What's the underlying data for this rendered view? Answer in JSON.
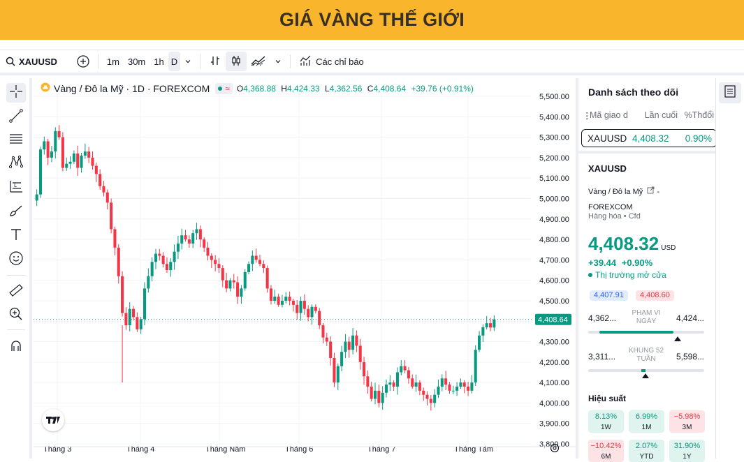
{
  "banner": {
    "title": "GIÁ VÀNG THẾ GIỚI"
  },
  "toolbar": {
    "symbol": "XAUUSD",
    "intervals": [
      "1m",
      "30m",
      "1h",
      "D"
    ],
    "indicators_label": "Các chỉ báo"
  },
  "legend": {
    "title": "Vàng / Đô la Mỹ · 1D · FOREXCOM",
    "o_label": "O",
    "o": "4,368.88",
    "h_label": "H",
    "h": "4,424.33",
    "l_label": "L",
    "l": "4,362.56",
    "c_label": "C",
    "c": "4,408.64",
    "change": "+39.76 (+0.91%)"
  },
  "price_tag": "4,408.64",
  "colors": {
    "up": "#089981",
    "down": "#f23645",
    "banner": "#f9b62d",
    "accent": "#2962ff"
  },
  "chart_data": {
    "type": "candlestick",
    "symbol": "XAUUSD",
    "y_ticks": [
      "5,500.00",
      "5,400.00",
      "5,300.00",
      "5,200.00",
      "5,100.00",
      "5,000.00",
      "4,900.00",
      "4,800.00",
      "4,700.00",
      "4,600.00",
      "4,500.00",
      "4,400.00",
      "4,300.00",
      "4,200.00",
      "4,100.00",
      "4,000.00",
      "3,900.00",
      "3,800.00"
    ],
    "ylim": [
      3800,
      5500
    ],
    "x_labels": [
      "Tháng 3",
      "Tháng 4",
      "Tháng Năm",
      "Tháng 6",
      "Tháng 7",
      "Tháng Tám"
    ],
    "last_price": 4408.64,
    "close_series": [
      5020,
      5240,
      5280,
      5200,
      5230,
      5330,
      5300,
      5150,
      5170,
      5180,
      5220,
      5150,
      5210,
      5230,
      5200,
      5160,
      5120,
      5060,
      5030,
      4980,
      4850,
      4760,
      4620,
      4440,
      4380,
      4460,
      4420,
      4360,
      4410,
      4560,
      4620,
      4690,
      4730,
      4720,
      4680,
      4650,
      4690,
      4740,
      4780,
      4820,
      4800,
      4780,
      4830,
      4850,
      4800,
      4760,
      4720,
      4700,
      4680,
      4660,
      4600,
      4560,
      4600,
      4590,
      4520,
      4560,
      4640,
      4680,
      4720,
      4700,
      4680,
      4660,
      4560,
      4500,
      4520,
      4480,
      4500,
      4520,
      4500,
      4480,
      4440,
      4500,
      4460,
      4420,
      4470,
      4450,
      4380,
      4320,
      4300,
      4220,
      4100,
      4180,
      4250,
      4300,
      4260,
      4330,
      4280,
      4200,
      4130,
      4080,
      4020,
      4060,
      4000,
      4050,
      4090,
      4100,
      4080,
      4150,
      4180,
      4160,
      4120,
      4080,
      4100,
      4060,
      4040,
      4020,
      4000,
      4040,
      4080,
      4120,
      4090,
      4060,
      4060,
      4080,
      4100,
      4080,
      4060,
      4100,
      4260,
      4330,
      4370,
      4390,
      4369,
      4409
    ],
    "grid": true
  },
  "watchlist": {
    "title": "Danh sách theo dõi",
    "columns": [
      "Mã giao d",
      "Lần cuối",
      "%Thđổi"
    ],
    "rows": [
      {
        "symbol": "XAUUSD",
        "last": "4,408.32",
        "change": "0.90%"
      }
    ]
  },
  "details": {
    "symbol": "XAUUSD",
    "description": "Vàng / Đô la Mỹ",
    "exchange": "FOREXCOM",
    "category": "Hàng hóa",
    "type": "Cfd",
    "price": "4,408.32",
    "currency": "USD",
    "change_abs": "+39.44",
    "change_pct": "+0.90%",
    "market_status": "Thị trường mở cửa",
    "bid": "4,407.91",
    "ask": "4,408.60",
    "day_range": {
      "low": "4,362...",
      "high": "4,424...",
      "label_1": "PHẠM VI",
      "label_2": "NGÀY"
    },
    "week52_range": {
      "low": "3,311...",
      "high": "5,598...",
      "label_1": "KHUNG 52",
      "label_2": "TUẦN"
    },
    "performance_title": "Hiệu suất",
    "performance": [
      {
        "value": "8.13%",
        "label": "1W",
        "sign": "pos"
      },
      {
        "value": "6.99%",
        "label": "1M",
        "sign": "pos"
      },
      {
        "value": "−5.98%",
        "label": "3M",
        "sign": "neg"
      },
      {
        "value": "−10.42%",
        "label": "6M",
        "sign": "neg"
      },
      {
        "value": "2.07%",
        "label": "YTD",
        "sign": "pos"
      },
      {
        "value": "31.90%",
        "label": "1Y",
        "sign": "pos"
      }
    ]
  }
}
